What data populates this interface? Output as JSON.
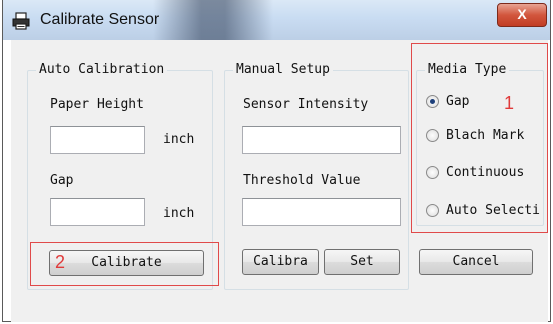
{
  "window": {
    "title": "Calibrate Sensor",
    "close_glyph": "X",
    "icon": "printer-icon"
  },
  "auto_calibration": {
    "group_label": "Auto Calibration",
    "paper_height_label": "Paper Height",
    "paper_height_value": "",
    "paper_height_unit": "inch",
    "gap_label": "Gap",
    "gap_value": "",
    "gap_unit": "inch",
    "calibrate_button": "Calibrate"
  },
  "manual_setup": {
    "group_label": "Manual Setup",
    "sensor_intensity_label": "Sensor Intensity",
    "sensor_intensity_value": "",
    "threshold_label": "Threshold Value",
    "threshold_value": "",
    "calibrate_button": "Calibra",
    "set_button": "Set"
  },
  "media_type": {
    "group_label": "Media Type",
    "options": [
      "Gap",
      "Blach Mark",
      "Continuous",
      "Auto Selecti"
    ],
    "selected": "Gap"
  },
  "cancel_button": "Cancel",
  "annotations": {
    "media_type_number": "1",
    "calibrate_number": "2",
    "color": "#e03a3a"
  }
}
